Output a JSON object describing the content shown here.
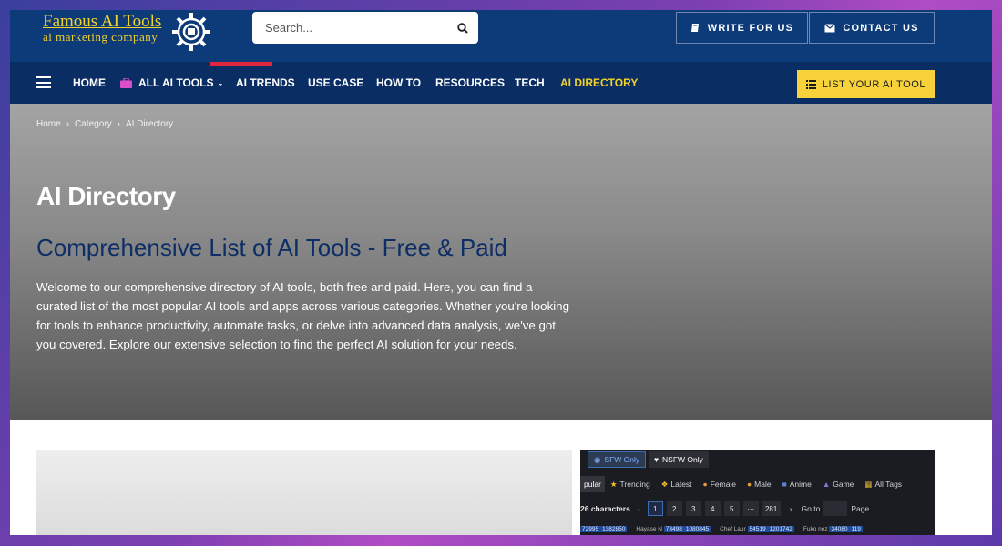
{
  "colors": {
    "topbar": "#0d3a78",
    "navbar": "#0a2d63",
    "accent_yellow": "#f2d22b",
    "list_button": "#f7d23a",
    "subtitle_blue": "#0d2d66"
  },
  "header": {
    "logo_title": "Famous AI Tools",
    "logo_subtitle": "ai marketing company",
    "logo_icon": "gear-wheel-logo",
    "search_placeholder": "Search...",
    "write_button": "WRITE FOR US",
    "write_icon": "book-icon",
    "contact_button": "CONTACT US",
    "contact_icon": "envelope-icon"
  },
  "nav": {
    "items": [
      {
        "label": "HOME"
      },
      {
        "label": "ALL AI TOOLS",
        "icon": "briefcase-icon",
        "dropdown": true
      },
      {
        "label": "AI TRENDS"
      },
      {
        "label": "USE CASE"
      },
      {
        "label": "HOW TO"
      },
      {
        "label": "RESOURCES"
      },
      {
        "label": "TECH"
      },
      {
        "label": "AI DIRECTORY",
        "active": true
      }
    ],
    "list_button": "LIST YOUR AI TOOL",
    "list_icon": "list-icon"
  },
  "hero": {
    "breadcrumbs": [
      "Home",
      "Category",
      "AI Directory"
    ],
    "title": "AI Directory",
    "subtitle": "Comprehensive List of AI Tools - Free & Paid",
    "description": "Welcome to our comprehensive directory of AI tools, both free and paid. Here, you can find a curated list of the most popular AI tools and apps across various categories. Whether you're looking for tools to enhance productivity, automate tasks, or delve into advanced data analysis, we've got you covered. Explore our extensive selection to find the perfect AI solution for your needs."
  },
  "preview": {
    "sfw": "SFW Only",
    "nsfw": "NSFW Only",
    "tabs": [
      "pular",
      "Trending",
      "Latest",
      "Female",
      "Male",
      "Anime",
      "Game",
      "All Tags"
    ],
    "characters": "26 characters",
    "pages": [
      "1",
      "2",
      "3",
      "4",
      "5",
      "···",
      "281"
    ],
    "goto": "Go to",
    "page_label": "Page",
    "stats": [
      {
        "count": "72995",
        "likes": "1382850"
      },
      {
        "name": "Hayase N",
        "count": "73498",
        "likes": "1080845"
      },
      {
        "name": "Chef Laur",
        "count": "54519",
        "likes": "1201742"
      },
      {
        "name": "Fuko nez",
        "count": "34080",
        "likes": "119"
      }
    ]
  }
}
